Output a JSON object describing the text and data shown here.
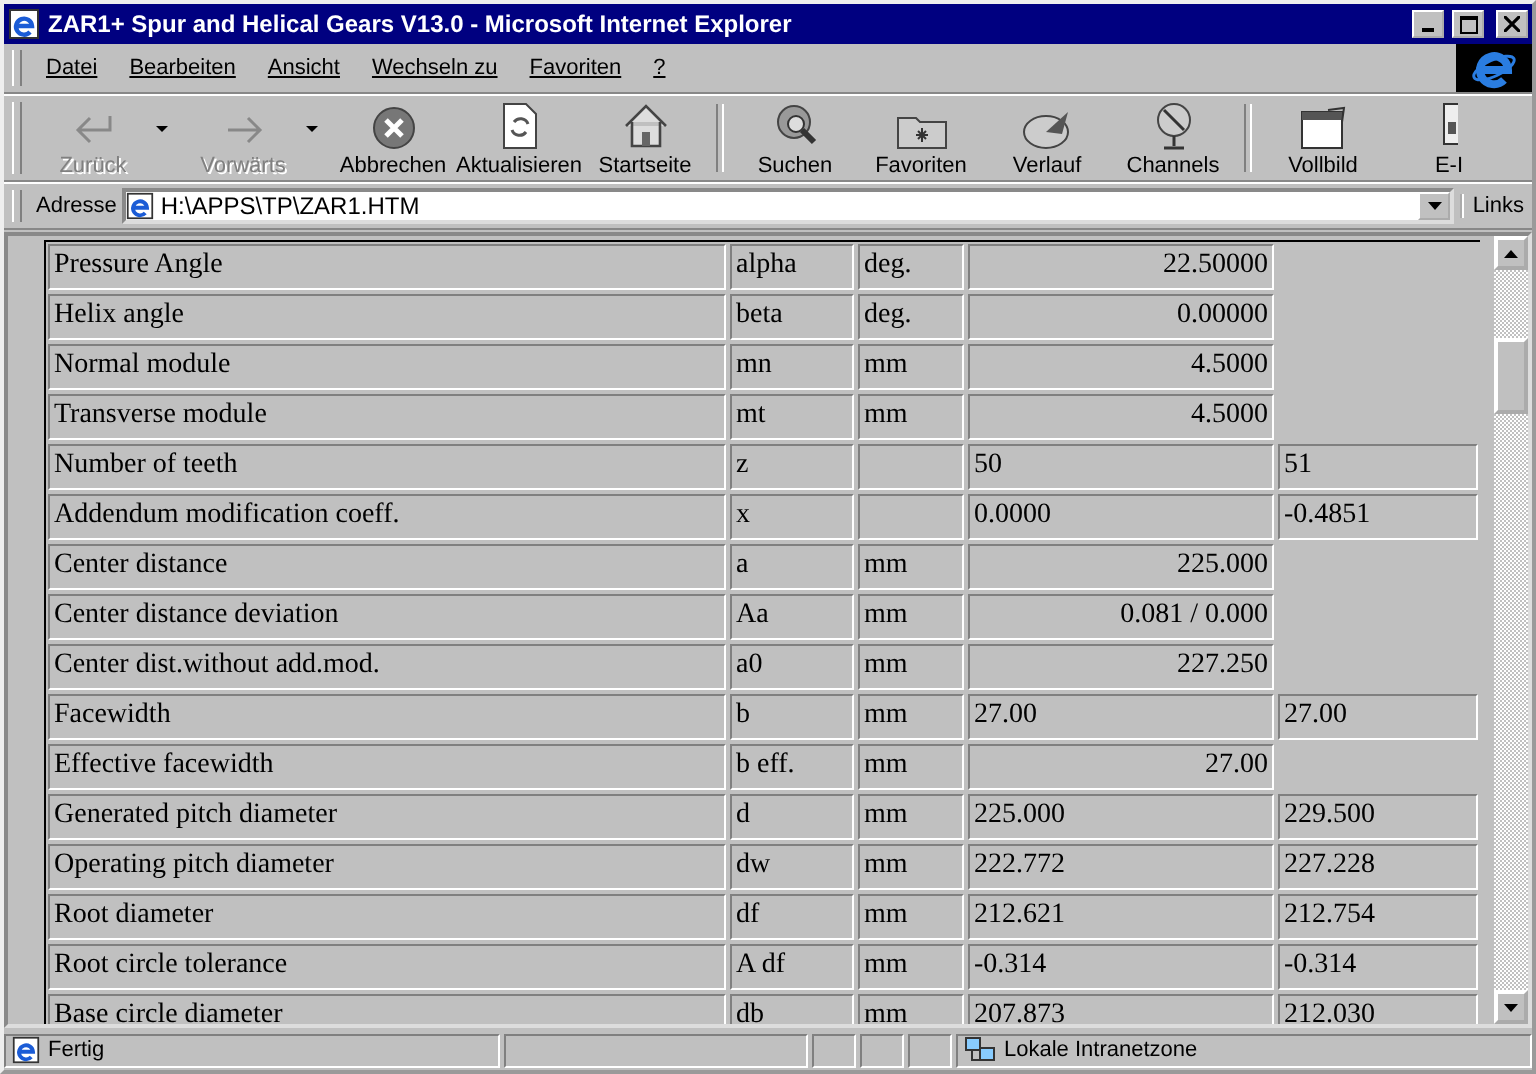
{
  "window": {
    "title": "ZAR1+ Spur and Helical Gears V13.0 - Microsoft Internet Explorer"
  },
  "menu": [
    "Datei",
    "Bearbeiten",
    "Ansicht",
    "Wechseln zu",
    "Favoriten",
    "?"
  ],
  "toolbar": [
    {
      "kind": "back",
      "label": "Zurück",
      "disabled": true,
      "dropdown": true
    },
    {
      "kind": "forward",
      "label": "Vorwärts",
      "disabled": true,
      "dropdown": true
    },
    {
      "kind": "stop",
      "label": "Abbrechen",
      "disabled": false,
      "dropdown": false
    },
    {
      "kind": "refresh",
      "label": "Aktualisieren",
      "disabled": false,
      "dropdown": false
    },
    {
      "kind": "home",
      "label": "Startseite",
      "disabled": false,
      "dropdown": false
    },
    {
      "kind": "search",
      "label": "Suchen",
      "disabled": false,
      "dropdown": false
    },
    {
      "kind": "favorites",
      "label": "Favoriten",
      "disabled": false,
      "dropdown": false
    },
    {
      "kind": "history",
      "label": "Verlauf",
      "disabled": false,
      "dropdown": false
    },
    {
      "kind": "channels",
      "label": "Channels",
      "disabled": false,
      "dropdown": false
    },
    {
      "kind": "fullscreen",
      "label": "Vollbild",
      "disabled": false,
      "dropdown": false
    },
    {
      "kind": "mail",
      "label": "E-I",
      "disabled": false,
      "dropdown": false
    }
  ],
  "address": {
    "label": "Adresse",
    "value": "H:\\APPS\\TP\\ZAR1.HTM",
    "links": "Links"
  },
  "table": {
    "rows": [
      {
        "kind": "single",
        "name": "Pressure Angle",
        "symbol": "alpha",
        "unit": "deg.",
        "values": [
          "22.50000"
        ]
      },
      {
        "kind": "single",
        "name": "Helix angle",
        "symbol": "beta",
        "unit": "deg.",
        "values": [
          "0.00000"
        ]
      },
      {
        "kind": "single",
        "name": "Normal module",
        "symbol": "mn",
        "unit": "mm",
        "values": [
          "4.5000"
        ]
      },
      {
        "kind": "single",
        "name": "Transverse module",
        "symbol": "mt",
        "unit": "mm",
        "values": [
          "4.5000"
        ]
      },
      {
        "kind": "pair",
        "name": "Number of teeth",
        "symbol": "z",
        "values": [
          "50",
          "51"
        ]
      },
      {
        "kind": "pair",
        "name": "Addendum modification coeff.",
        "symbol": "x",
        "values": [
          "0.0000",
          "-0.4851"
        ]
      },
      {
        "kind": "single",
        "name": "Center distance",
        "symbol": "a",
        "unit": "mm",
        "values": [
          "225.000"
        ]
      },
      {
        "kind": "single",
        "name": "Center distance deviation",
        "symbol": "Aa",
        "unit": "mm",
        "values": [
          "0.081 / 0.000"
        ]
      },
      {
        "kind": "single",
        "name": "Center dist.without add.mod.",
        "symbol": "a0",
        "unit": "mm",
        "values": [
          "227.250"
        ]
      },
      {
        "kind": "pair",
        "name": "Facewidth",
        "symbol": "b",
        "unit": "mm",
        "values": [
          "27.00",
          "27.00"
        ]
      },
      {
        "kind": "single",
        "name": "Effective facewidth",
        "symbol": "b eff.",
        "unit": "mm",
        "values": [
          "27.00"
        ]
      },
      {
        "kind": "pair",
        "name": "Generated pitch diameter",
        "symbol": "d",
        "unit": "mm",
        "values": [
          "225.000",
          "229.500"
        ]
      },
      {
        "kind": "pair",
        "name": "Operating pitch diameter",
        "symbol": "dw",
        "unit": "mm",
        "values": [
          "222.772",
          "227.228"
        ]
      },
      {
        "kind": "pair",
        "name": "Root diameter",
        "symbol": "df",
        "unit": "mm",
        "values": [
          "212.621",
          "212.754"
        ]
      },
      {
        "kind": "pair",
        "name": "Root circle tolerance",
        "symbol": "A df",
        "unit": "mm",
        "values": [
          "-0.314",
          "-0.314"
        ]
      },
      {
        "kind": "pair",
        "name": "Base circle diameter",
        "symbol": "db",
        "unit": "mm",
        "values": [
          "207.873",
          "212.030"
        ]
      }
    ]
  },
  "status_bar": {
    "text": "Fertig",
    "zone": "Lokale Intranetzone"
  }
}
